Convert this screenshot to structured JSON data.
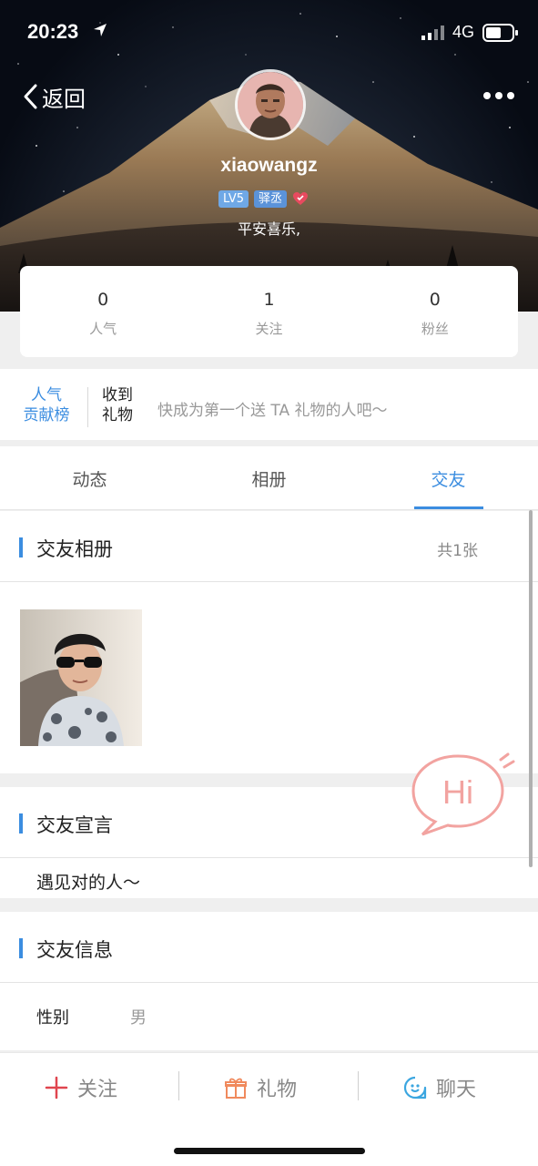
{
  "status_bar": {
    "time": "20:23",
    "network": "4G"
  },
  "header": {
    "back_label": "返回"
  },
  "profile": {
    "username": "xiaowangz",
    "level_badge": "LV5",
    "role_badge": "驿丞",
    "signature": "平安喜乐,"
  },
  "stats": [
    {
      "value": "0",
      "label": "人气"
    },
    {
      "value": "1",
      "label": "关注"
    },
    {
      "value": "0",
      "label": "粉丝"
    }
  ],
  "gifts": {
    "rank_line1": "人气",
    "rank_line2": "贡献榜",
    "received_line1": "收到",
    "received_line2": "礼物",
    "hint": "快成为第一个送 TA 礼物的人吧～"
  },
  "tabs": [
    {
      "label": "动态",
      "active": false
    },
    {
      "label": "相册",
      "active": false
    },
    {
      "label": "交友",
      "active": true
    }
  ],
  "album": {
    "title": "交友相册",
    "count": "共1张"
  },
  "declaration": {
    "title": "交友宣言",
    "text": "遇见对的人～"
  },
  "info": {
    "title": "交友信息",
    "rows": [
      {
        "label": "性别",
        "value": "男"
      }
    ]
  },
  "hi_button": {
    "text": "Hi"
  },
  "bottom_bar": {
    "follow": "关注",
    "gift": "礼物",
    "chat": "聊天"
  },
  "colors": {
    "accent": "#3b8de0",
    "follow": "#e0454f",
    "gift": "#f08a5d",
    "chat": "#3ba6e0",
    "hi": "#f2a3a0"
  }
}
